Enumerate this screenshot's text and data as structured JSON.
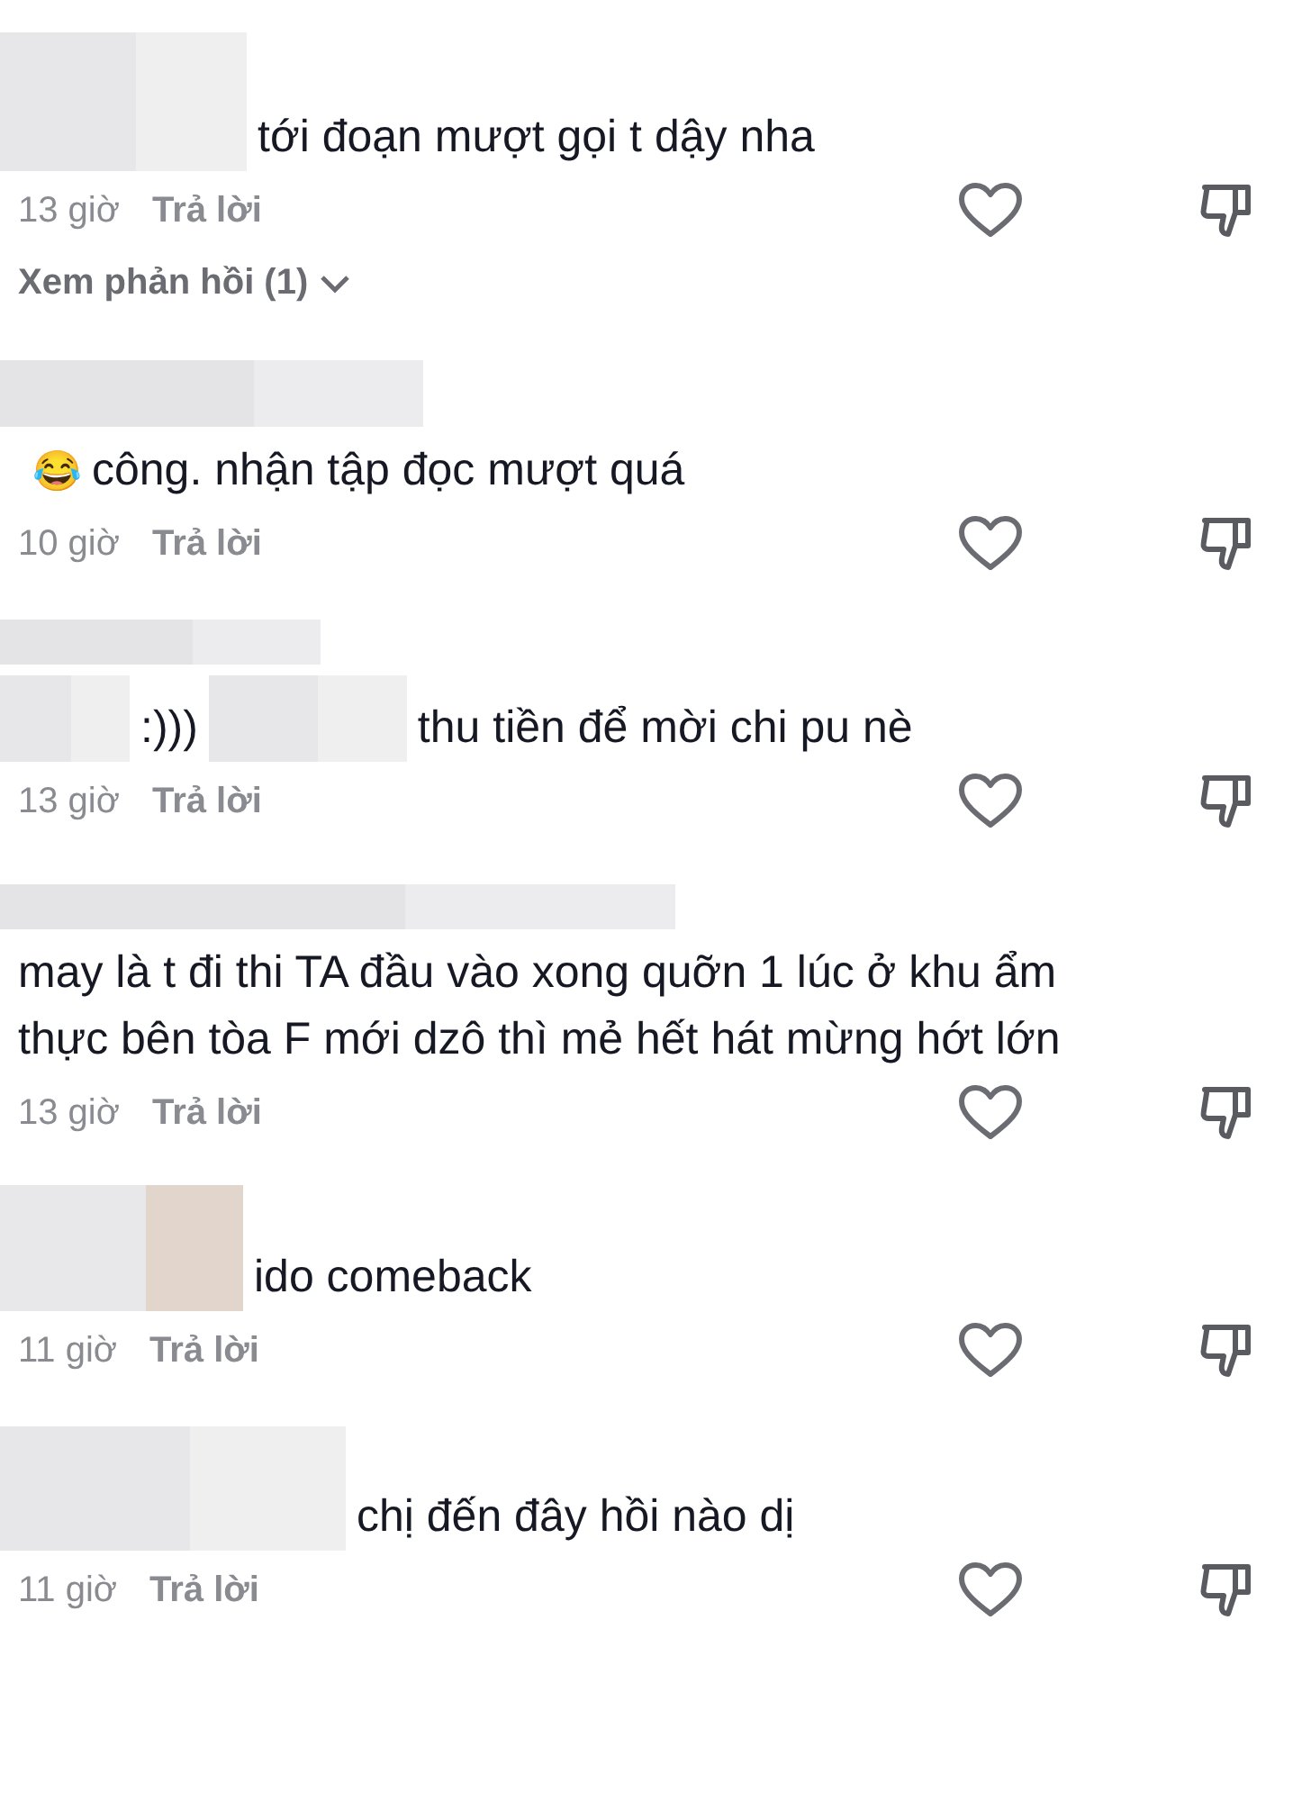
{
  "comments": [
    {
      "head": false,
      "body": [
        {
          "kind": "redacted"
        },
        {
          "kind": "text",
          "text": "tới đoạn mượt gọi t dậy nha"
        }
      ],
      "time": "13 giờ",
      "reply": "Trả lời",
      "replies_link": "Xem phản hồi (1)"
    },
    {
      "head": true,
      "body": [
        {
          "kind": "emoji",
          "text": "😂"
        },
        {
          "kind": "text",
          "text": "công. nhận tập đọc mượt quá"
        }
      ],
      "time": "10 giờ",
      "reply": "Trả lời"
    },
    {
      "head": true,
      "body": [
        {
          "kind": "redacted"
        },
        {
          "kind": "text",
          "text": ":)))"
        },
        {
          "kind": "redacted"
        },
        {
          "kind": "text",
          "text": "thu tiền để mời chi pu nè"
        }
      ],
      "time": "13 giờ",
      "reply": "Trả lời"
    },
    {
      "head": true,
      "body": [
        {
          "kind": "text",
          "text": "may là t đi thi TA đầu vào xong quỡn 1 lúc ở khu ẩm thực bên tòa F mới dzô thì mẻ hết hát mừng hớt lớn"
        }
      ],
      "time": "13 giờ",
      "reply": "Trả lời"
    },
    {
      "head": false,
      "body": [
        {
          "kind": "redacted"
        },
        {
          "kind": "text",
          "text": "ido comeback"
        }
      ],
      "time": "11 giờ",
      "reply": "Trả lời"
    },
    {
      "head": false,
      "body": [
        {
          "kind": "redacted"
        },
        {
          "kind": "text",
          "text": "chị đến đây hồi nào dị"
        }
      ],
      "time": "11 giờ",
      "reply": "Trả lời"
    }
  ]
}
